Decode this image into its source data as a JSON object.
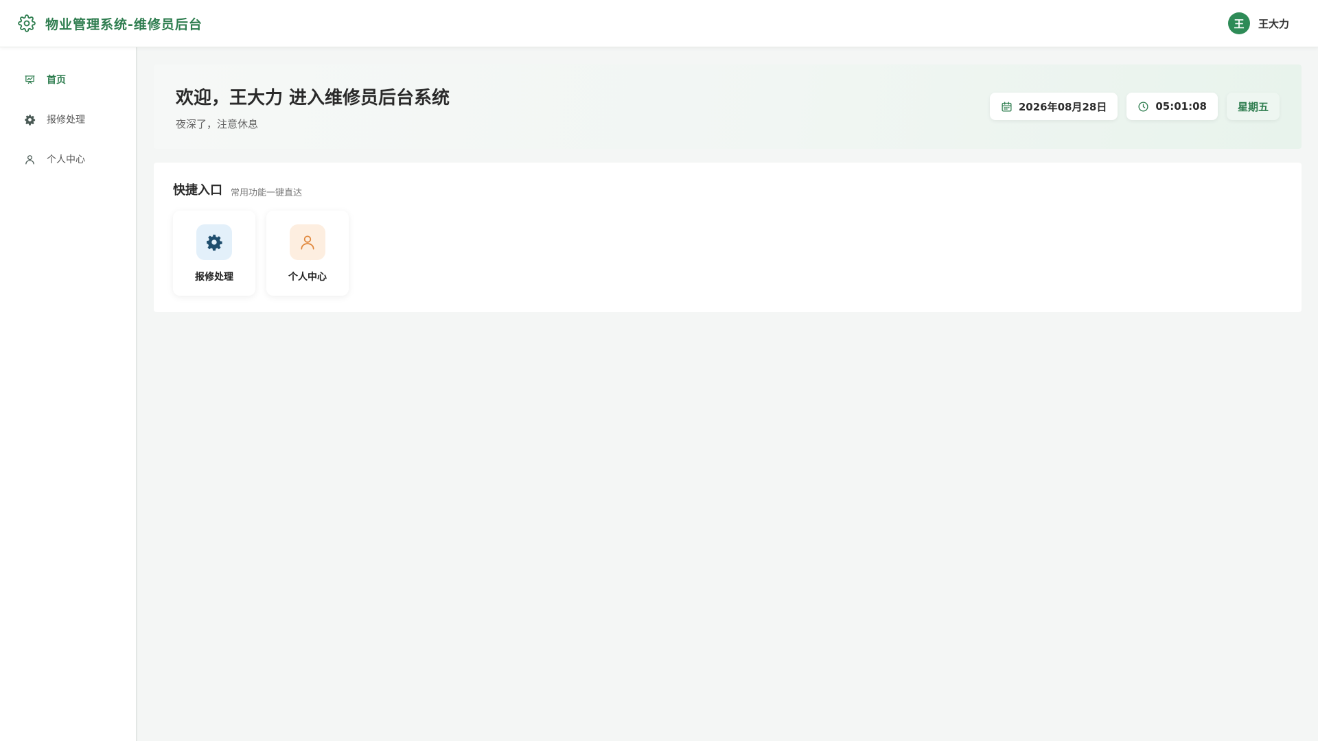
{
  "header": {
    "brand_icon": "gear-icon",
    "title": "物业管理系统-维修员后台",
    "avatar_letter": "王",
    "username": "王大力"
  },
  "sidebar": {
    "items": [
      {
        "label": "首页",
        "icon": "presentation-chart-icon",
        "active": true
      },
      {
        "label": "报修处理",
        "icon": "gear-icon",
        "active": false
      },
      {
        "label": "个人中心",
        "icon": "user-icon",
        "active": false
      }
    ]
  },
  "banner": {
    "title": "欢迎，王大力 进入维修员后台系统",
    "subtitle": "夜深了，注意休息",
    "date": "2026年08月28日",
    "time": "05:01:08",
    "weekday": "星期五"
  },
  "quick": {
    "title": "快捷入口",
    "subtitle": "常用功能一键直达",
    "tiles": [
      {
        "label": "报修处理",
        "icon": "gear-icon",
        "color": "#1f4e6e"
      },
      {
        "label": "个人中心",
        "icon": "user-icon",
        "color": "#e0863a"
      }
    ]
  },
  "colors": {
    "accent": "#2e7d4f",
    "avatar": "#2e8b57",
    "background": "#f4f6f5"
  }
}
